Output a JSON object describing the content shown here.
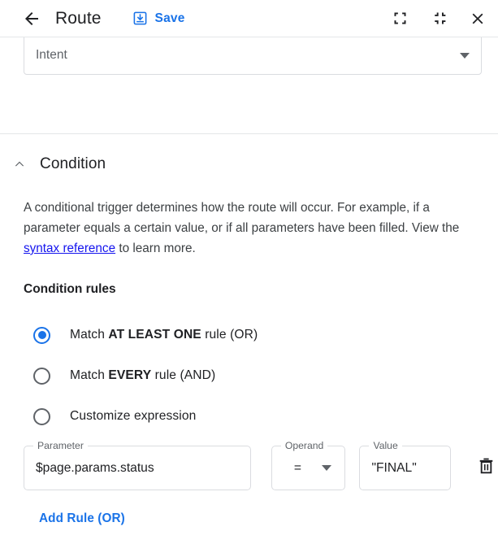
{
  "header": {
    "back_icon": "arrow-left-icon",
    "title": "Route",
    "save_icon": "save-download-icon",
    "save_label": "Save",
    "fullscreen_icon": "fullscreen-expand-icon",
    "collapse_icon": "fullscreen-collapse-icon",
    "close_icon": "close-x-icon",
    "accent_color": "#1a73e8"
  },
  "intent": {
    "label": "Intent",
    "caret_icon": "chevron-down-icon"
  },
  "condition": {
    "collapse_icon": "chevron-up-icon",
    "title": "Condition",
    "description_pre": "A conditional trigger determines how the route will occur. For example, if a parameter equals a certain value, or if all parameters have been filled. View the ",
    "link_text": "syntax reference",
    "description_post": " to learn more.",
    "link_color": "#1414ee",
    "rules_heading": "Condition rules",
    "options": [
      {
        "label_pre": "Match ",
        "label_bold": "AT LEAST ONE",
        "label_post": " rule (OR)",
        "selected": true
      },
      {
        "label_pre": "Match ",
        "label_bold": "EVERY",
        "label_post": " rule (AND)",
        "selected": false
      },
      {
        "label_pre": "Customize expression",
        "label_bold": "",
        "label_post": "",
        "selected": false
      }
    ],
    "rule": {
      "parameter_label": "Parameter",
      "parameter_value": "$page.params.status",
      "operand_label": "Operand",
      "operand_value": "=",
      "operand_caret_icon": "chevron-down-icon",
      "value_label": "Value",
      "value_value": "\"FINAL\"",
      "delete_icon": "trash-delete-icon"
    },
    "add_rule_label": "Add Rule (OR)"
  }
}
